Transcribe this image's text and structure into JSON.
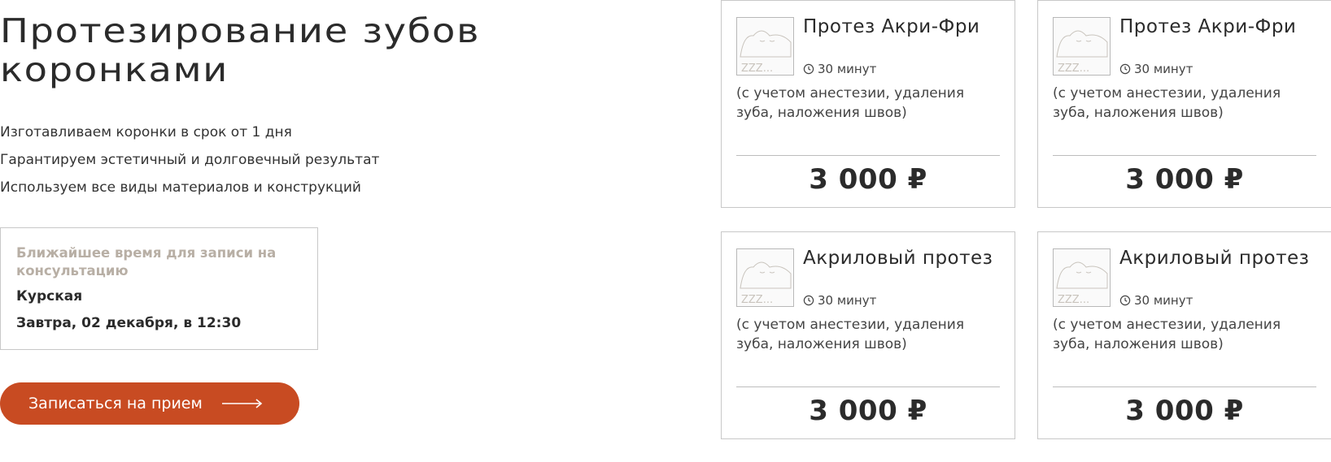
{
  "page": {
    "title": "Протезирование зубов коронками",
    "benefits": [
      "Изготавливаем коронки в срок от 1 дня",
      "Гарантируем эстетичный и долговечный результат",
      "Используем все виды материалов и конструкций"
    ]
  },
  "slot": {
    "heading": "Ближайшее время для записи на консультацию",
    "location": "Курская",
    "time": "Завтра, 02 декабря, в 12:30"
  },
  "book_button": {
    "label": "Записаться на прием"
  },
  "cards": [
    {
      "name": "Протез Акри-Фри",
      "duration": "30 минут",
      "description": "(с учетом анестезии, удаления зуба, наложения швов)",
      "price": "3 000 ₽",
      "thumb_text": "ZZZ..."
    },
    {
      "name": "Протез Акри-Фри",
      "duration": "30 минут",
      "description": "(с учетом анестезии, удаления зуба, наложения швов)",
      "price": "3 000 ₽",
      "thumb_text": "ZZZ..."
    },
    {
      "name": "Акриловый протез",
      "duration": "30 минут",
      "description": "(с учетом анестезии, удаления зуба, наложения швов)",
      "price": "3 000 ₽",
      "thumb_text": "ZZZ..."
    },
    {
      "name": "Акриловый протез",
      "duration": "30 минут",
      "description": "(с учетом анестезии, удаления зуба, наложения швов)",
      "price": "3 000 ₽",
      "thumb_text": "ZZZ..."
    }
  ],
  "colors": {
    "accent": "#c84b22",
    "muted_heading": "#b8afa5",
    "border": "#c8c8c8",
    "text": "#2b2b2b"
  }
}
